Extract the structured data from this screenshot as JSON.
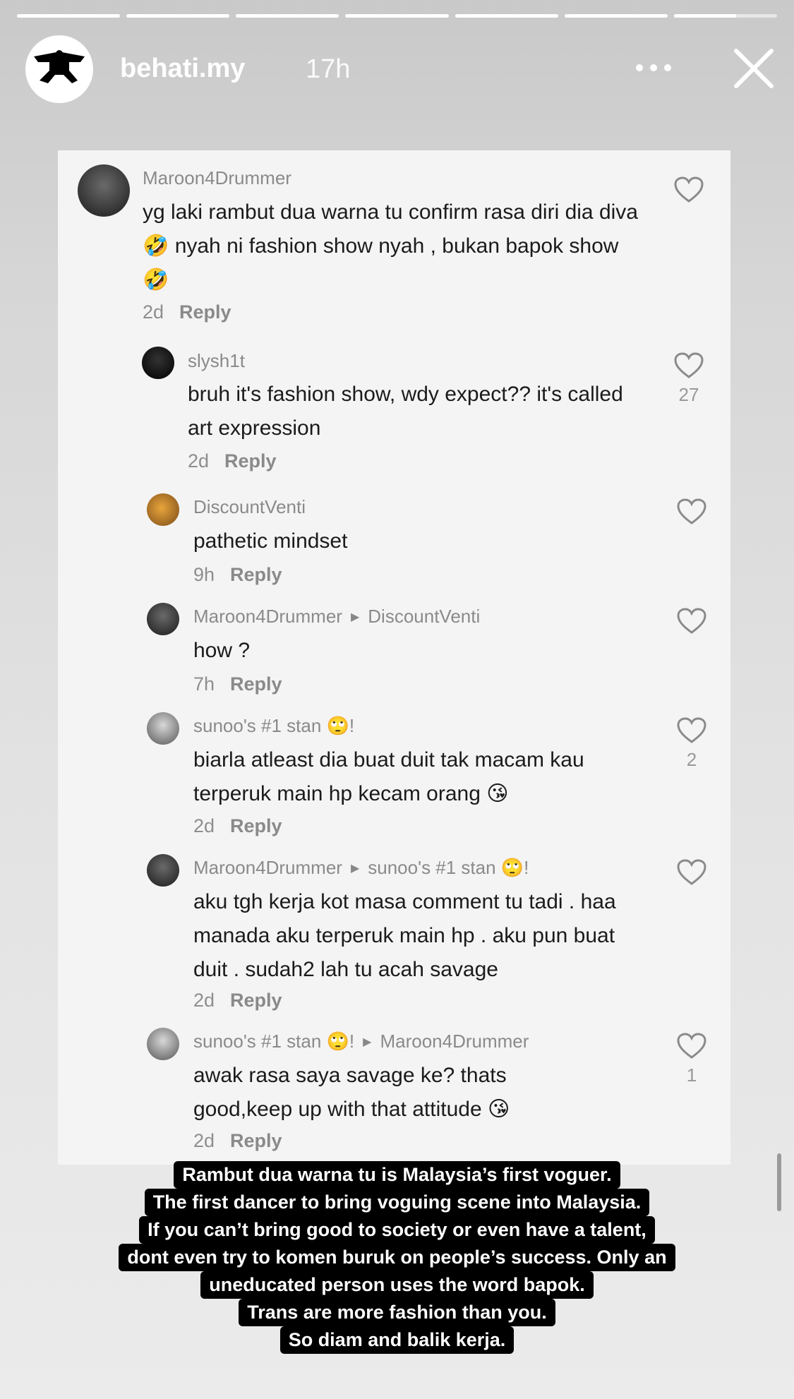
{
  "story": {
    "username": "behati.my",
    "age": "17h",
    "segments": [
      1,
      1,
      1,
      1,
      1,
      1,
      0.6
    ]
  },
  "comments": [
    {
      "user": "Maroon4Drummer",
      "text": "yg laki rambut dua warna tu confirm rasa diri dia diva 🤣 nyah ni fashion show nyah , bukan bapok show 🤣",
      "time": "2d",
      "reply": "Reply",
      "likes": ""
    },
    {
      "user": "slysh1t",
      "text": "bruh it's fashion show, wdy expect?? it's called art expression",
      "time": "2d",
      "reply": "Reply",
      "likes": "27"
    },
    {
      "user": "DiscountVenti",
      "text": "pathetic mindset",
      "time": "9h",
      "reply": "Reply",
      "likes": ""
    },
    {
      "user": "Maroon4Drummer",
      "reply_to": "DiscountVenti",
      "text": "how ?",
      "time": "7h",
      "reply": "Reply",
      "likes": ""
    },
    {
      "user": "sunoo's #1 stan 🙄!",
      "text": "biarla atleast dia buat duit tak macam kau terperuk main hp kecam orang 😘",
      "time": "2d",
      "reply": "Reply",
      "likes": "2"
    },
    {
      "user": "Maroon4Drummer",
      "reply_to": "sunoo's #1 stan 🙄!",
      "text": "aku tgh kerja kot masa comment tu tadi . haa manada aku terperuk main hp . aku pun buat duit . sudah2 lah tu acah savage",
      "time": "2d",
      "reply": "Reply",
      "likes": ""
    },
    {
      "user": "sunoo's #1 stan 🙄!",
      "reply_to": "Maroon4Drummer",
      "text": "awak rasa saya savage ke? thats good,keep up with that attitude 😘",
      "time": "2d",
      "reply": "Reply",
      "likes": "1"
    }
  ],
  "caption": [
    "Rambut dua warna tu is Malaysia’s first voguer.",
    "The first dancer to bring voguing scene into Malaysia.",
    "If you can’t bring good to society or even have a talent,",
    "dont even try to komen buruk on people’s success. Only an",
    "uneducated person uses the word bapok.",
    "Trans are more fashion than you.",
    "So diam and balik kerja."
  ]
}
